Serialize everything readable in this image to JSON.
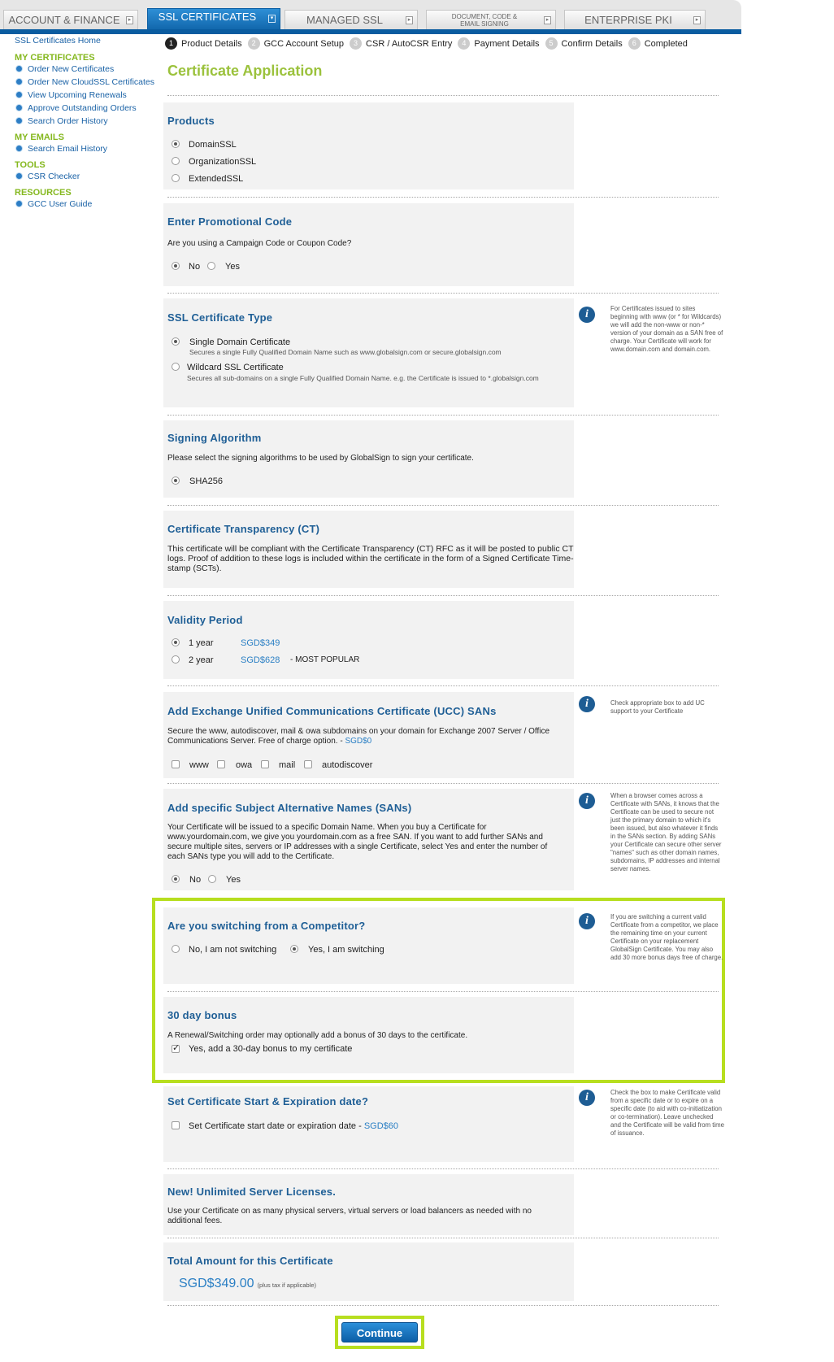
{
  "tabs": [
    {
      "label": "ACCOUNT & FINANCE"
    },
    {
      "label": "SSL CERTIFICATES"
    },
    {
      "label": "MANAGED SSL"
    },
    {
      "label": "DOCUMENT, CODE & EMAIL SIGNING"
    },
    {
      "label": "ENTERPRISE PKI"
    }
  ],
  "sidebar": {
    "home": "SSL Certificates Home",
    "groups": [
      {
        "heading": "MY CERTIFICATES",
        "items": [
          "Order New Certificates",
          "Order New CloudSSL Certificates",
          "View Upcoming Renewals",
          "Approve Outstanding Orders",
          "Search Order History"
        ]
      },
      {
        "heading": "MY EMAILS",
        "items": [
          "Search Email History"
        ]
      },
      {
        "heading": "TOOLS",
        "items": [
          "CSR Checker"
        ]
      },
      {
        "heading": "RESOURCES",
        "items": [
          "GCC User Guide"
        ]
      }
    ]
  },
  "steps": [
    {
      "num": "1",
      "label": "Product Details"
    },
    {
      "num": "2",
      "label": "GCC Account Setup"
    },
    {
      "num": "3",
      "label": "CSR / AutoCSR Entry"
    },
    {
      "num": "4",
      "label": "Payment Details"
    },
    {
      "num": "5",
      "label": "Confirm Details"
    },
    {
      "num": "6",
      "label": "Completed"
    }
  ],
  "page_title": "Certificate Application",
  "products": {
    "title": "Products",
    "options": [
      "DomainSSL",
      "OrganizationSSL",
      "ExtendedSSL"
    ],
    "selected": "DomainSSL"
  },
  "promo": {
    "title": "Enter Promotional Code",
    "question": "Are you using a Campaign Code or Coupon Code?",
    "no": "No",
    "yes": "Yes"
  },
  "ssl_type": {
    "title": "SSL Certificate Type",
    "single": {
      "label": "Single Domain Certificate",
      "desc": "Secures a single Fully Qualified Domain Name such as www.globalsign.com or secure.globalsign.com"
    },
    "wildcard": {
      "label": "Wildcard SSL Certificate",
      "desc": "Secures all sub-domains on a single Fully Qualified Domain Name. e.g. the Certificate is issued to *.globalsign.com"
    },
    "help": "For Certificates issued to sites beginning with www (or * for Wildcards) we will add the non-www or non-* version of your domain as a SAN free of charge. Your Certificate will work for www.domain.com and domain.com."
  },
  "signing": {
    "title": "Signing Algorithm",
    "desc": "Please select the signing algorithms to be used by GlobalSign to sign your certificate.",
    "option": "SHA256"
  },
  "ct": {
    "title": "Certificate Transparency (CT)",
    "desc": "This certificate will be compliant with the Certificate Transparency (CT) RFC as it will be posted to public CT logs. Proof of addition to these logs is included within the certificate in the form of a Signed Certificate Time-stamp (SCTs)."
  },
  "validity": {
    "title": "Validity Period",
    "options": [
      {
        "label": "1 year",
        "price": "SGD$349",
        "note": ""
      },
      {
        "label": "2 year",
        "price": "SGD$628",
        "note": "- MOST POPULAR"
      }
    ]
  },
  "ucc": {
    "title": "Add Exchange Unified Communications Certificate (UCC) SANs",
    "desc": "Secure the www, autodiscover, mail & owa subdomains on your domain for Exchange 2007 Server / Office Communications Server. Free of charge option. - ",
    "price": "SGD$0",
    "options": [
      "www",
      "owa",
      "mail",
      "autodiscover"
    ],
    "help": "Check appropriate box to add UC support to your Certificate"
  },
  "sans": {
    "title": "Add specific Subject Alternative Names (SANs)",
    "desc": "Your Certificate will be issued to a specific Domain Name. When you buy a Certificate for www.yourdomain.com, we give you yourdomain.com as a free SAN. If you want to add further SANs and secure multiple sites, servers or IP addresses with a single Certificate, select Yes and enter the number of each SANs type you will add to the Certificate.",
    "no": "No",
    "yes": "Yes",
    "help": "When a browser comes across a Certificate with SANs, it knows that the Certificate can be used to secure not just the primary domain to which it's been issued, but also whatever it finds in the SANs section. By adding SANs your Certificate can secure other server \"names\" such as other domain names, subdomains, IP addresses and internal server names."
  },
  "competitor": {
    "title": "Are you switching from a Competitor?",
    "no": "No, I am not switching",
    "yes": "Yes, I am switching",
    "help": "If you are switching a current valid Certificate from a competitor, we place the remaining time on your current Certificate on your replacement GlobalSign Certificate. You may also add 30 more bonus days free of charge."
  },
  "bonus": {
    "title": "30 day bonus",
    "desc": "A Renewal/Switching order may optionally add a bonus of 30 days to the certificate.",
    "option": "Yes, add a 30-day bonus to my certificate"
  },
  "expiration": {
    "title": "Set Certificate Start & Expiration date?",
    "option": "Set Certificate start date or expiration date - ",
    "price": "SGD$60",
    "help": "Check the box to make Certificate valid from a specific date or to expire on a specific date (to aid with co-initiatization or co-termination). Leave unchecked and the Certificate will be valid from time of issuance."
  },
  "licenses": {
    "title": "New! Unlimited Server Licenses.",
    "desc": "Use your Certificate on as many physical servers, virtual servers or load balancers as needed with no additional fees."
  },
  "total": {
    "title": "Total Amount for this Certificate",
    "amount": "SGD$349.00",
    "note": "(plus tax if applicable)"
  },
  "continue_label": "Continue",
  "colors": {
    "accent_green": "#b7de1f",
    "title_blue": "#1f5f96",
    "tab_blue": "#0b5ea3"
  }
}
